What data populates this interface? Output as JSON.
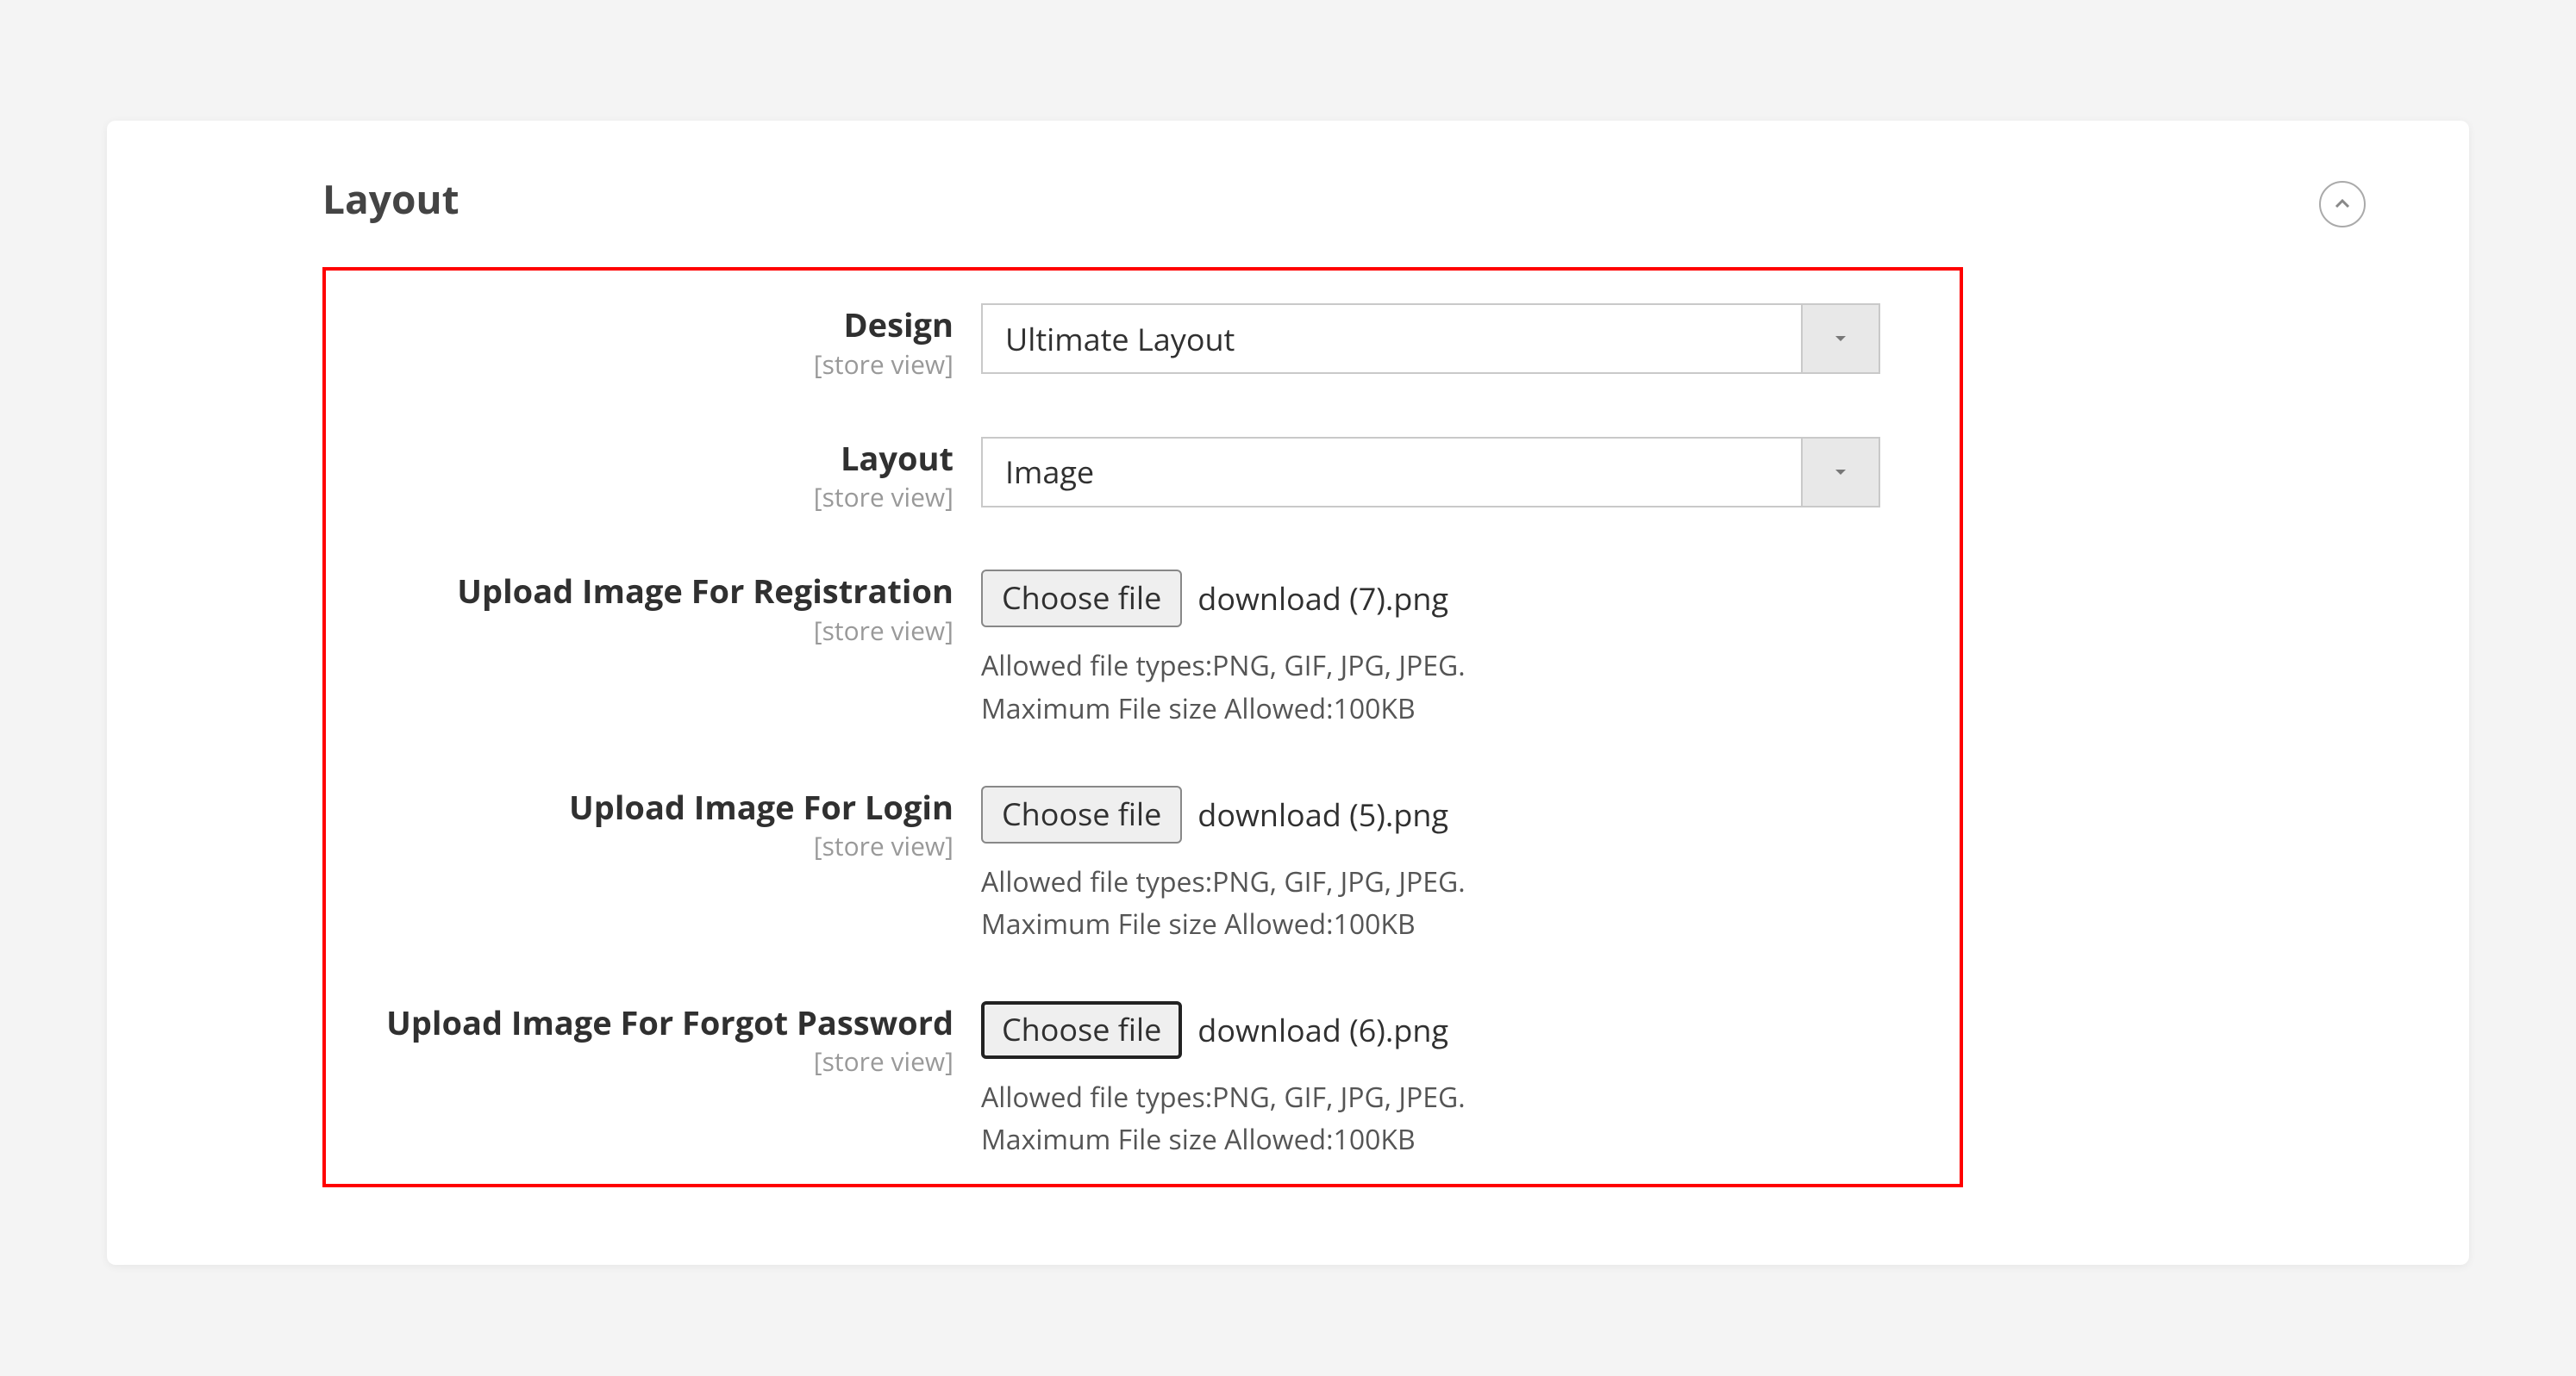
{
  "section": {
    "title": "Layout"
  },
  "scope_label": "[store view]",
  "fields": {
    "design": {
      "label": "Design",
      "value": "Ultimate Layout"
    },
    "layout": {
      "label": "Layout",
      "value": "Image"
    },
    "upload_registration": {
      "label": "Upload Image For Registration",
      "button_label": "Choose file",
      "file_name": "download (7).png",
      "hint": "Allowed file types:PNG, GIF, JPG, JPEG.\nMaximum File size Allowed:100KB"
    },
    "upload_login": {
      "label": "Upload Image For Login",
      "button_label": "Choose file",
      "file_name": "download (5).png",
      "hint": "Allowed file types:PNG, GIF, JPG, JPEG.\nMaximum File size Allowed:100KB"
    },
    "upload_forgot": {
      "label": "Upload Image For Forgot Password",
      "button_label": "Choose file",
      "file_name": "download (6).png",
      "hint": "Allowed file types:PNG, GIF, JPG, JPEG.\nMaximum File size Allowed:100KB"
    }
  }
}
